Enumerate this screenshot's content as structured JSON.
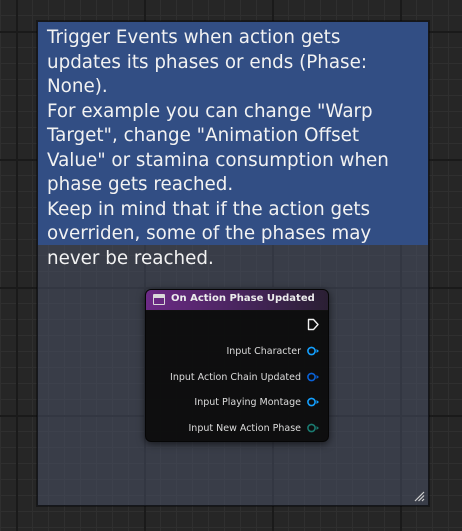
{
  "comment": {
    "text": "Trigger Events when action gets updates its phases or ends (Phase: None).\nFor example you can change \"Warp Target\", change \"Animation Offset Value\" or stamina consumption when phase gets reached.\nKeep in mind that if the action gets overriden, some of the phases may never be reached.",
    "color": "#324e84"
  },
  "node": {
    "title": "On Action Phase Updated",
    "header_color": "#6c2a86",
    "exec_pin_icon": "exec-arrow-icon",
    "pins": [
      {
        "label": "Input Character",
        "color": "#14a0ff"
      },
      {
        "label": "Input Action Chain Updated",
        "color": "#0a62d8"
      },
      {
        "label": "Input Playing Montage",
        "color": "#14a0ff"
      },
      {
        "label": "Input New Action Phase",
        "color": "#1a7a70"
      }
    ]
  }
}
